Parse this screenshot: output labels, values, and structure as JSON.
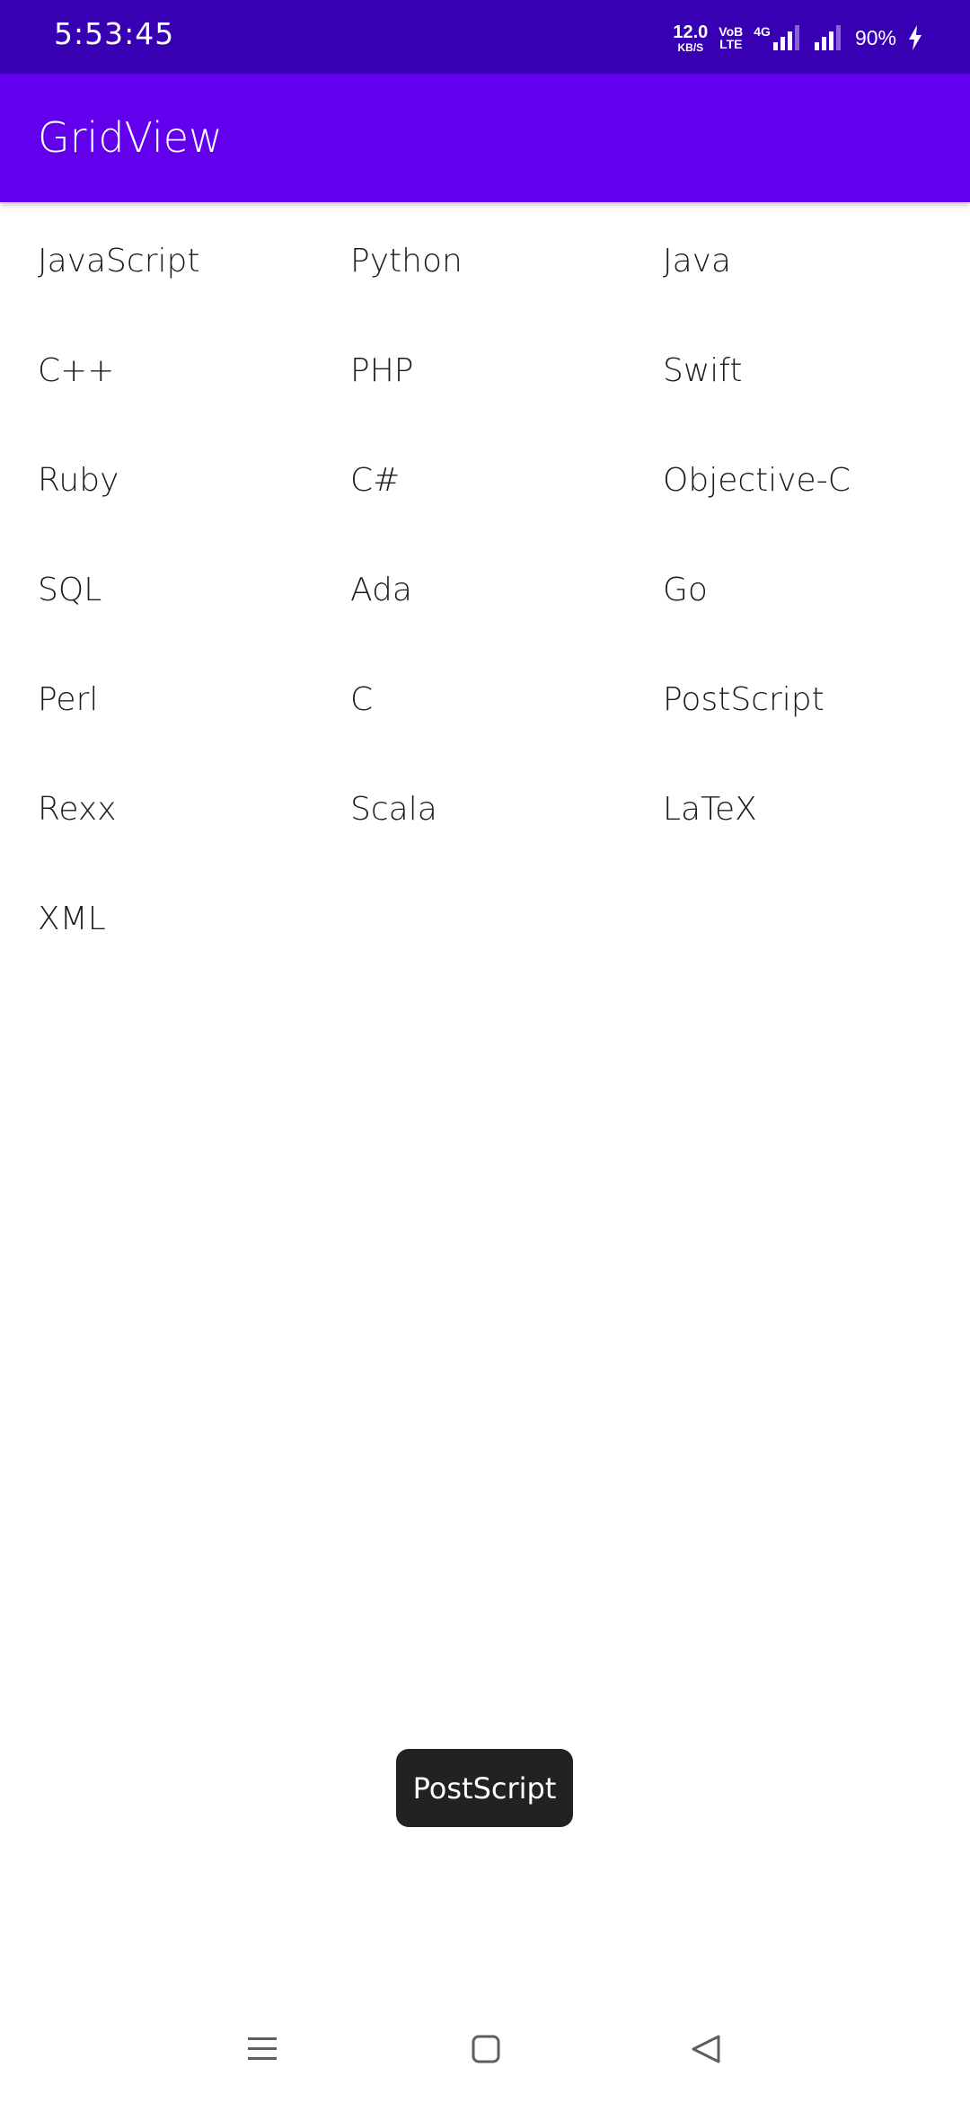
{
  "status_bar": {
    "time": "5:53:45",
    "net_speed_value": "12.0",
    "net_speed_unit": "KB/S",
    "volte_top": "VoB",
    "volte_bottom": "LTE",
    "network_type": "4G",
    "battery": "90%"
  },
  "app_bar": {
    "title": "GridView"
  },
  "grid": {
    "items": [
      "JavaScript",
      "Python",
      "Java",
      "C++",
      "PHP",
      "Swift",
      "Ruby",
      "C#",
      "Objective-C",
      "SQL",
      "Ada",
      "Go",
      "Perl",
      "C",
      "PostScript",
      "Rexx",
      "Scala",
      "LaTeX",
      "XML"
    ]
  },
  "toast": {
    "text": "PostScript"
  },
  "colors": {
    "status_bar": "#3700b3",
    "app_bar": "#6200ee",
    "toast_bg": "#222222"
  },
  "nav_bar": {
    "icons": [
      "menu-icon",
      "home-icon",
      "back-icon"
    ]
  }
}
